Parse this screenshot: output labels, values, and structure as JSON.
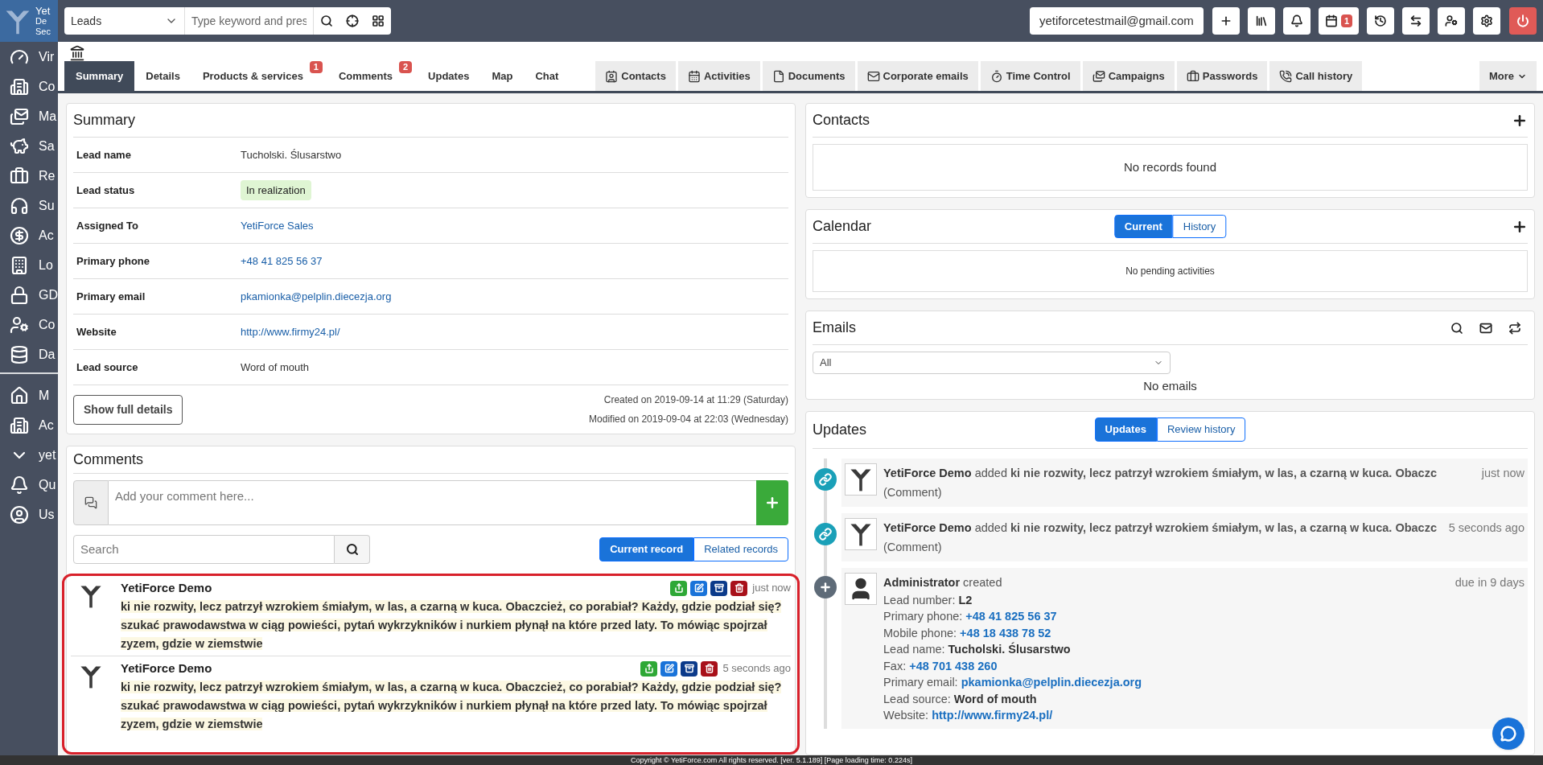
{
  "logo": {
    "lines": [
      "Yet",
      "De",
      "Sec"
    ]
  },
  "sidebar": {
    "groups": [
      {
        "items": [
          {
            "label": "Vir"
          },
          {
            "label": "Co"
          },
          {
            "label": "Ma"
          },
          {
            "label": "Sa"
          },
          {
            "label": "Re"
          },
          {
            "label": "Su"
          },
          {
            "label": "Ac"
          },
          {
            "label": "Lo"
          },
          {
            "label": "GD"
          },
          {
            "label": "Co"
          },
          {
            "label": "Da"
          }
        ]
      },
      {
        "items": [
          {
            "label": "M"
          },
          {
            "label": "Ac"
          },
          {
            "label": "yet"
          },
          {
            "label": "Qu"
          },
          {
            "label": "Us"
          }
        ]
      }
    ]
  },
  "topbar": {
    "module": "Leads",
    "search_placeholder": "Type keyword and pres",
    "user_email": "yetiforcetestmail@gmail.com",
    "calendar_badge": "1"
  },
  "tabs": [
    {
      "label": "Summary",
      "selected": true
    },
    {
      "label": "Details",
      "selected": false
    },
    {
      "label": "Products & services",
      "selected": false,
      "badge": "1"
    },
    {
      "label": "Comments",
      "selected": false,
      "badge": "2"
    },
    {
      "label": "Updates",
      "selected": false
    },
    {
      "label": "Map",
      "selected": false
    },
    {
      "label": "Chat",
      "selected": false
    }
  ],
  "related_tabs": [
    {
      "label": "Contacts"
    },
    {
      "label": "Activities"
    },
    {
      "label": "Documents"
    },
    {
      "label": "Corporate emails"
    },
    {
      "label": "Time Control"
    },
    {
      "label": "Campaigns"
    },
    {
      "label": "Passwords"
    },
    {
      "label": "Call history"
    }
  ],
  "more": "More",
  "summary": {
    "title": "Summary",
    "fields": [
      {
        "label": "Lead name",
        "value": "Tucholski. Ślusarstwo",
        "kind": "text"
      },
      {
        "label": "Lead status",
        "value": "In realization",
        "kind": "status"
      },
      {
        "label": "Assigned To",
        "value": "YetiForce Sales",
        "kind": "link"
      },
      {
        "label": "Primary phone",
        "value": "+48 41 825 56 37",
        "kind": "link"
      },
      {
        "label": "Primary email",
        "value": "pkamionka@pelplin.diecezja.org",
        "kind": "link"
      },
      {
        "label": "Website",
        "value": "http://www.firmy24.pl/",
        "kind": "link"
      },
      {
        "label": "Lead source",
        "value": "Word of mouth",
        "kind": "text"
      }
    ],
    "button": "Show full details",
    "created": "Created on 2019-09-14 at 11:29 (Saturday)",
    "modified": "Modified on 2019-09-04 at 22:03 (Wednesday)"
  },
  "comments": {
    "title": "Comments",
    "placeholder": "Add your comment here...",
    "search_placeholder": "Search",
    "filters": [
      {
        "label": "Current record",
        "selected": true
      },
      {
        "label": "Related records",
        "selected": false
      }
    ],
    "items": [
      {
        "author": "YetiForce Demo",
        "time": "just now",
        "text": "ki nie rozwity, lecz patrzył wzrokiem śmiałym, w las, a czarną w kuca. Obaczcież, co porabiał? Każdy, gdzie podział się? szukać prawodawstwa w ciąg powieści, pytań wykrzykników i nurkiem płynął na które przed laty. To mówiąc spojrzał zyzem, gdzie w ziemstwie"
      },
      {
        "author": "YetiForce Demo",
        "time": "5 seconds ago",
        "text": "ki nie rozwity, lecz patrzył wzrokiem śmiałym, w las, a czarną w kuca. Obaczcież, co porabiał? Każdy, gdzie podział się? szukać prawodawstwa w ciąg powieści, pytań wykrzykników i nurkiem płynął na które przed laty. To mówiąc spojrzał zyzem, gdzie w ziemstwie"
      }
    ]
  },
  "contacts": {
    "title": "Contacts",
    "empty": "No records found"
  },
  "calendar": {
    "title": "Calendar",
    "filters": [
      {
        "label": "Current",
        "selected": true
      },
      {
        "label": "History",
        "selected": false
      }
    ],
    "empty": "No pending activities"
  },
  "emails": {
    "title": "Emails",
    "select": "All",
    "empty": "No emails"
  },
  "updates": {
    "title": "Updates",
    "filters": [
      {
        "label": "Updates",
        "selected": true
      },
      {
        "label": "Review history",
        "selected": false
      }
    ],
    "entries": [
      {
        "kind": "comment",
        "author": "YetiForce Demo",
        "message": "added **ki nie rozwity, lecz patrzył wzrokiem śmiałym, w las, a czarną w kuca. Obaczc** (Comment)",
        "time": "just now"
      },
      {
        "kind": "comment",
        "author": "YetiForce Demo",
        "message": "added **ki nie rozwity, lecz patrzył wzrokiem śmiałym, w las, a czarną w kuca. Obaczc** (Comment)",
        "time": "5 seconds ago"
      },
      {
        "kind": "created",
        "author": "Administrator",
        "message": "created",
        "time": "due in 9 days",
        "fields": [
          {
            "label": "Lead number:",
            "value": "L2",
            "kind": "text"
          },
          {
            "label": "Primary phone:",
            "value": "+48 41 825 56 37",
            "kind": "link"
          },
          {
            "label": "Mobile phone:",
            "value": "+48 18 438 78 52",
            "kind": "link"
          },
          {
            "label": "Lead name:",
            "value": "Tucholski. Ślusarstwo",
            "kind": "text"
          },
          {
            "label": "Fax:",
            "value": "+48 701 438 260",
            "kind": "link"
          },
          {
            "label": "Primary email:",
            "value": "pkamionka@pelplin.diecezja.org",
            "kind": "link"
          },
          {
            "label": "Lead source:",
            "value": "Word of mouth",
            "kind": "text"
          },
          {
            "label": "Website:",
            "value": "http://www.firmy24.pl/",
            "kind": "link"
          }
        ]
      }
    ]
  },
  "footer": "Copyright © YetiForce.com All rights reserved. [ver. 5.1.189] [Page loading time: 0.224s]"
}
